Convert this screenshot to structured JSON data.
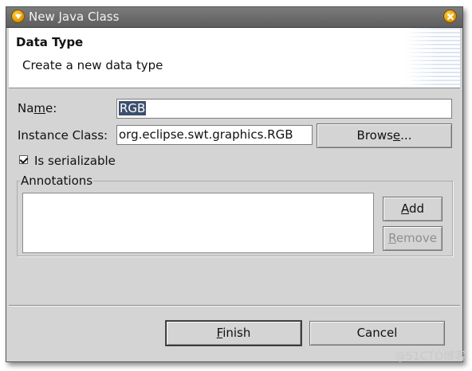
{
  "window": {
    "title": "New Java Class"
  },
  "header": {
    "title": "Data Type",
    "description": "Create a new data type"
  },
  "form": {
    "name_label_pre": "Na",
    "name_label_accel": "m",
    "name_label_post": "e:",
    "name_value": "RGB",
    "instance_class_label": "Instance Class:",
    "instance_class_value": "org.eclipse.swt.graphics.RGB",
    "browse_pre": "Brows",
    "browse_accel": "e",
    "browse_post": "...",
    "serializable_label": "Is serializable",
    "serializable_checked": true
  },
  "annotations": {
    "group_label": "Annotations",
    "add_accel": "A",
    "add_post": "dd",
    "remove_accel": "R",
    "remove_post": "emove"
  },
  "footer": {
    "finish_accel": "F",
    "finish_post": "inish",
    "cancel_label": "Cancel"
  },
  "watermark": "@51CTO博客"
}
